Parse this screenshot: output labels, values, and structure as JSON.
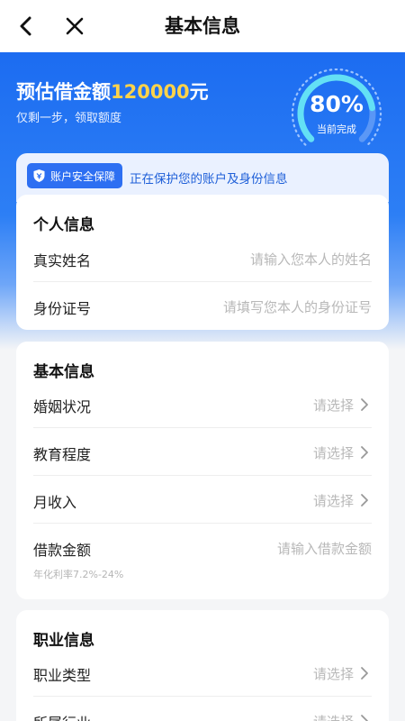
{
  "nav": {
    "title": "基本信息"
  },
  "hero": {
    "amount_prefix": "预估借金额",
    "amount_value": "120000",
    "amount_suffix": "元",
    "subtitle": "仅剩一步，领取额度",
    "progress_percent": 80,
    "progress_text": "80%",
    "progress_label": "当前完成"
  },
  "security": {
    "badge_label": "账户安全保障",
    "message": "正在保护您的账户及身份信息"
  },
  "personal": {
    "title": "个人信息",
    "fields": [
      {
        "label": "真实姓名",
        "placeholder": "请输入您本人的姓名"
      },
      {
        "label": "身份证号",
        "placeholder": "请填写您本人的身份证号"
      }
    ]
  },
  "basic": {
    "title": "基本信息",
    "fields": [
      {
        "label": "婚姻状况",
        "placeholder": "请选择"
      },
      {
        "label": "教育程度",
        "placeholder": "请选择"
      },
      {
        "label": "月收入",
        "placeholder": "请选择"
      },
      {
        "label": "借款金额",
        "placeholder": "请输入借款金额"
      }
    ],
    "rate_note": "年化利率7.2%-24%"
  },
  "job": {
    "title": "职业信息",
    "fields": [
      {
        "label": "职业类型",
        "placeholder": "请选择"
      },
      {
        "label": "所属行业",
        "placeholder": "请选择"
      }
    ]
  },
  "colors": {
    "primary": "#1c6cf1",
    "accent": "#ffd34a",
    "background": "#f4f5f7"
  }
}
